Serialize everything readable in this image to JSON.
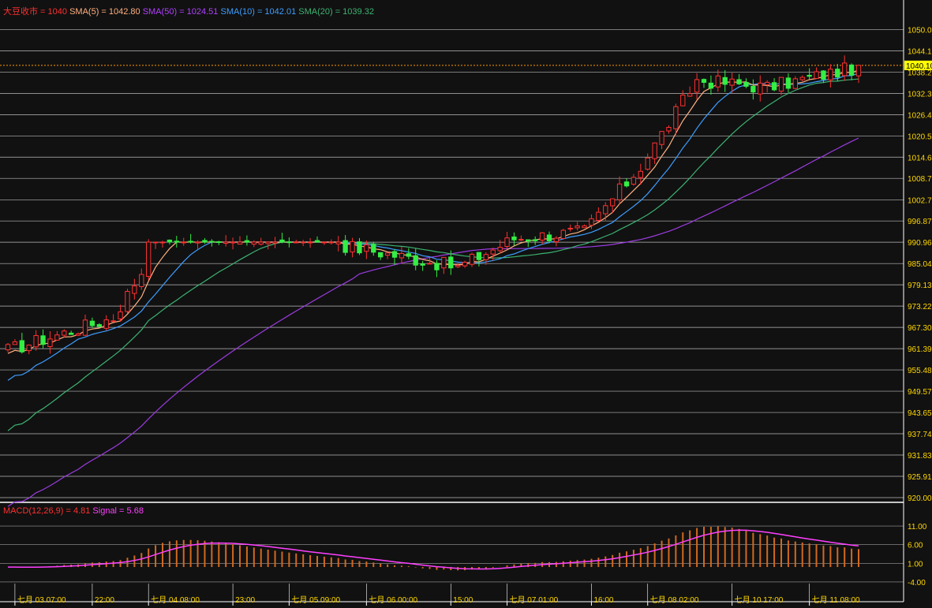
{
  "legend_main": [
    {
      "text": "大豆收市 = 1040",
      "color": "#ff3030"
    },
    {
      "text": "SMA(5) = 1042.80",
      "color": "#ffb080"
    },
    {
      "text": "SMA(50) = 1024.51",
      "color": "#b040ff"
    },
    {
      "text": "SMA(10) = 1042.01",
      "color": "#3d9dff"
    },
    {
      "text": "SMA(20) = 1039.32",
      "color": "#3cb371"
    }
  ],
  "legend_macd": [
    {
      "text": "MACD(12,26,9) = 4.81",
      "color": "#ff3030"
    },
    {
      "text": "Signal = 5.68",
      "color": "#ff40ff"
    }
  ],
  "current_price_label": "1040.10",
  "chart_data": {
    "type": "candlestick",
    "price_axis": {
      "ylim": [
        920.0,
        1053.0
      ],
      "tick_labels": [
        "1050.0",
        "1044.1",
        "1038.2",
        "1032.3",
        "1026.4",
        "1020.5",
        "1014.6",
        "1008.7",
        "1002.7",
        "996.87",
        "990.96",
        "985.04",
        "979.13",
        "973.22",
        "967.30",
        "961.39",
        "955.48",
        "949.57",
        "943.65",
        "937.74",
        "931.83",
        "925.91",
        "920.00"
      ],
      "tick_values": [
        1050.0,
        1044.1,
        1038.2,
        1032.3,
        1026.4,
        1020.5,
        1014.6,
        1008.7,
        1002.7,
        996.87,
        990.96,
        985.04,
        979.13,
        973.22,
        967.3,
        961.39,
        955.48,
        949.57,
        943.65,
        937.74,
        931.83,
        925.91,
        920.0
      ]
    },
    "macd_axis": {
      "ylim": [
        -5.5,
        12.5
      ],
      "tick_labels": [
        "11.00",
        "6.00",
        "1.00",
        "-4.00"
      ],
      "tick_values": [
        11.0,
        6.0,
        1.0,
        -4.0
      ]
    },
    "time_labels": [
      "七月 03 07:00",
      "22:00",
      "七月 04 08:00",
      "23:00",
      "七月 05 09:00",
      "七月 06 00:00",
      "15:00",
      "七月 07 01:00",
      "16:00",
      "七月 08 02:00",
      "七月 10 17:00",
      "七月 11 08:00"
    ],
    "time_label_index": [
      1,
      12,
      20,
      32,
      40,
      51,
      63,
      71,
      83,
      91,
      103,
      114
    ],
    "num_bars": 122,
    "last_close": 1040.1,
    "segments": [
      {
        "start": 0,
        "end": 15,
        "from": 961,
        "to": 970
      },
      {
        "start": 15,
        "end": 20,
        "from": 970,
        "to": 986
      },
      {
        "start": 20,
        "end": 48,
        "from": 991,
        "to": 991,
        "flat": true
      },
      {
        "start": 48,
        "end": 56,
        "from": 990,
        "to": 987
      },
      {
        "start": 56,
        "end": 64,
        "from": 987,
        "to": 984
      },
      {
        "start": 64,
        "end": 72,
        "from": 984,
        "to": 992
      },
      {
        "start": 72,
        "end": 82,
        "from": 992,
        "to": 994
      },
      {
        "start": 82,
        "end": 90,
        "from": 994,
        "to": 1012
      },
      {
        "start": 90,
        "end": 98,
        "from": 1012,
        "to": 1036
      },
      {
        "start": 98,
        "end": 108,
        "from": 1036,
        "to": 1034
      },
      {
        "start": 108,
        "end": 122,
        "from": 1034,
        "to": 1040.1
      }
    ],
    "sma_last": {
      "SMA(5)": 1042.8,
      "SMA(10)": 1042.01,
      "SMA(20)": 1039.32,
      "SMA(50)": 1024.51
    },
    "macd_last": {
      "MACD": 4.81,
      "Signal": 5.68
    },
    "colors": {
      "up": "#ff3030",
      "down": "#33ee44",
      "sma5": "#ffb080",
      "sma10": "#3d9dff",
      "sma20": "#3cb371",
      "sma50": "#9b3be0",
      "macd_bar": "#d2691e",
      "signal": "#ff40ff",
      "grid": "#ffffff",
      "axis_text": "#ffd700",
      "price_line": "#ff9a00"
    }
  }
}
